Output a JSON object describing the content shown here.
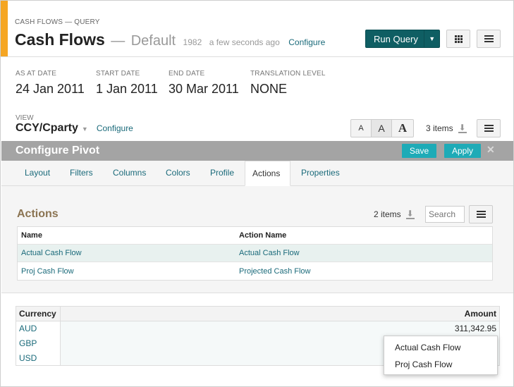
{
  "header": {
    "breadcrumb": "CASH FLOWS — QUERY",
    "title": "Cash Flows",
    "dash": "—",
    "subtitle": "Default",
    "count": "1982",
    "updated": "a few seconds ago",
    "configure_link": "Configure",
    "run_query_label": "Run Query",
    "accent_color": "#f5a623",
    "run_button_color": "#0f5e63"
  },
  "fields": [
    {
      "label": "AS AT DATE",
      "value": "24 Jan 2011"
    },
    {
      "label": "START DATE",
      "value": "1 Jan 2011"
    },
    {
      "label": "END DATE",
      "value": "30 Mar 2011"
    },
    {
      "label": "TRANSLATION LEVEL",
      "value": "NONE"
    }
  ],
  "view": {
    "label": "VIEW",
    "value": "CCY/Cparty",
    "configure_link": "Configure",
    "font_sizes": [
      "A",
      "A",
      "A"
    ],
    "items_count": "3 items"
  },
  "pivot": {
    "title": "Configure Pivot",
    "save_label": "Save",
    "apply_label": "Apply",
    "close_glyph": "✕",
    "button_color": "#1eabb7"
  },
  "tabs": [
    {
      "label": "Layout"
    },
    {
      "label": "Filters"
    },
    {
      "label": "Columns"
    },
    {
      "label": "Colors"
    },
    {
      "label": "Profile"
    },
    {
      "label": "Actions",
      "active": true
    },
    {
      "label": "Properties"
    }
  ],
  "actions": {
    "title": "Actions",
    "items_count": "2 items",
    "search_placeholder": "Search",
    "columns": [
      "Name",
      "Action Name"
    ],
    "rows": [
      {
        "name": "Actual Cash Flow",
        "action_name": "Actual Cash Flow",
        "selected": true
      },
      {
        "name": "Proj Cash Flow",
        "action_name": "Projected Cash Flow"
      }
    ]
  },
  "result": {
    "columns": [
      "Currency",
      "Amount"
    ],
    "rows": [
      {
        "currency": "AUD",
        "amount": "311,342.95"
      },
      {
        "currency": "GBP",
        "amount": ""
      },
      {
        "currency": "USD",
        "amount": ""
      }
    ]
  },
  "context_menu": {
    "items": [
      "Actual Cash Flow",
      "Proj Cash Flow"
    ]
  }
}
